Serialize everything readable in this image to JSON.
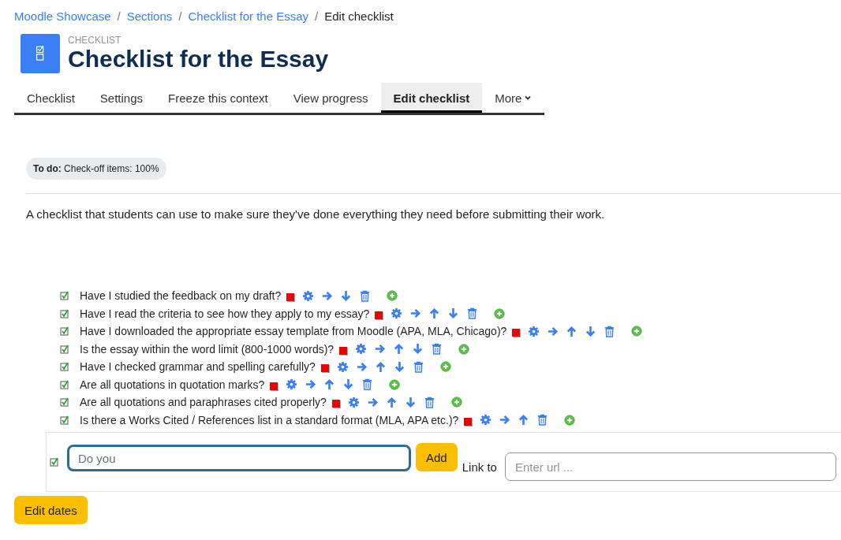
{
  "breadcrumb_separator": "/",
  "breadcrumbs": [
    {
      "label": "Moodle Showcase",
      "link": true
    },
    {
      "label": "Sections",
      "link": true
    },
    {
      "label": "Checklist for the Essay",
      "link": true
    },
    {
      "label": "Edit checklist",
      "link": false
    }
  ],
  "header": {
    "module_type": "CHECKLIST",
    "title": "Checklist for the Essay"
  },
  "tabs": [
    {
      "label": "Checklist",
      "selected": false
    },
    {
      "label": "Settings",
      "selected": false
    },
    {
      "label": "Freeze this context",
      "selected": false
    },
    {
      "label": "View progress",
      "selected": false
    },
    {
      "label": "Edit checklist",
      "selected": true
    },
    {
      "label": "More",
      "selected": false,
      "dropdown": true
    }
  ],
  "badge": {
    "label": "To do:",
    "text": "Check-off items: 100%"
  },
  "description": "A checklist that students can use to make sure they've done everything they need before submitting their work.",
  "items": [
    {
      "text": "Have I studied the feedback on my draft?",
      "move_up": false,
      "move_down": true
    },
    {
      "text": "Have I read the criteria to see how they apply to my essay?",
      "move_up": true,
      "move_down": true
    },
    {
      "text": "Have I downloaded the appropriate essay template from Moodle (APA, MLA, Chicago)?",
      "move_up": true,
      "move_down": true
    },
    {
      "text": "Is the essay within the word limit (800-1000 words)?",
      "move_up": true,
      "move_down": true
    },
    {
      "text": "Have I checked grammar and spelling carefully?",
      "move_up": true,
      "move_down": true
    },
    {
      "text": "Are all quotations in quotation marks?",
      "move_up": true,
      "move_down": true
    },
    {
      "text": "Are all quotations and paraphrases cited properly?",
      "move_up": true,
      "move_down": true
    },
    {
      "text": "Is there a Works Cited / References list in a standard format (MLA, APA etc.)?",
      "move_up": true,
      "move_down": false
    }
  ],
  "new_item": {
    "value": "Do you",
    "button": "Add",
    "link_label": "Link to",
    "link_placeholder": "Enter url ..."
  },
  "edit_dates_button": "Edit dates"
}
